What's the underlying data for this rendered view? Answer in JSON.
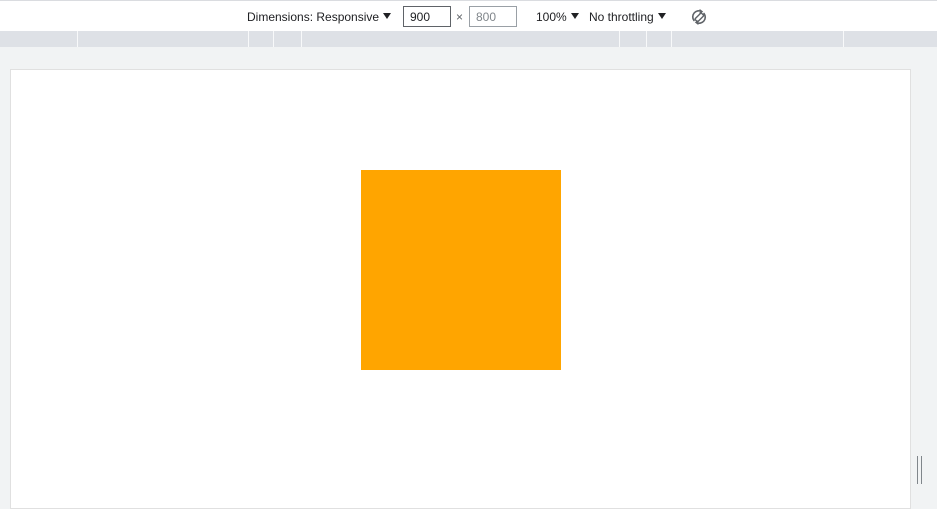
{
  "toolbar": {
    "dimensions_label": "Dimensions: Responsive",
    "width_value": "900",
    "height_placeholder": "800",
    "times_symbol": "×",
    "zoom_label": "100%",
    "throttling_label": "No throttling",
    "rotate_icon": "rotate-icon"
  },
  "page": {
    "box_color": "#ffa500"
  },
  "colors": {
    "toolbar_bg": "#ffffff",
    "ruler_bg": "#dee1e6",
    "outer_bg": "#f1f3f4",
    "viewport_bg": "#ffffff"
  }
}
